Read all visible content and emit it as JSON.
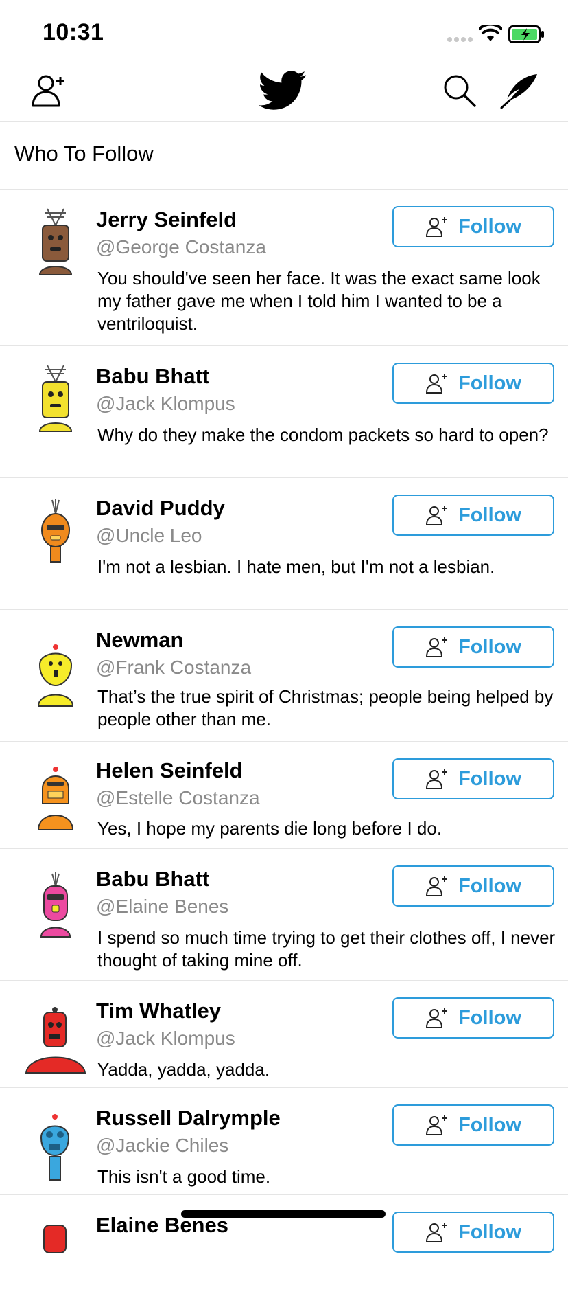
{
  "status_bar": {
    "time": "10:31"
  },
  "header": {
    "title": "Who To Follow"
  },
  "follow_label": "Follow",
  "suggestions": [
    {
      "name": "Jerry Seinfeld",
      "handle": "@George Costanza",
      "quote": "You should've seen her face. It was the exact same look my father gave me when I told him I wanted to be a ventriloquist.",
      "avatar_color": "#8a5a3b"
    },
    {
      "name": "Babu Bhatt",
      "handle": "@Jack Klompus",
      "quote": "Why do they make the condom packets so hard to open?",
      "avatar_color": "#f2e12e"
    },
    {
      "name": "David Puddy",
      "handle": "@Uncle Leo",
      "quote": "I'm not a lesbian. I hate men, but I'm not a lesbian.",
      "avatar_color": "#f08a1d"
    },
    {
      "name": "Newman",
      "handle": "@Frank Costanza",
      "quote": "That’s the true spirit of Christmas; people being helped by people other than me.",
      "avatar_color": "#f6ec2a"
    },
    {
      "name": "Helen Seinfeld",
      "handle": "@Estelle Costanza",
      "quote": "Yes, I hope my parents die long before I do.",
      "avatar_color": "#f5921e"
    },
    {
      "name": "Babu Bhatt",
      "handle": "@Elaine Benes",
      "quote": "I spend so much time trying to get their clothes off, I never thought of taking mine off.",
      "avatar_color": "#ec4aa0"
    },
    {
      "name": "Tim Whatley",
      "handle": "@Jack Klompus",
      "quote": "Yadda, yadda, yadda.",
      "avatar_color": "#e42a26"
    },
    {
      "name": "Russell Dalrymple",
      "handle": "@Jackie Chiles",
      "quote": "This isn't a good time.",
      "avatar_color": "#3aa7de"
    },
    {
      "name": "Elaine Benes",
      "handle": "",
      "quote": "",
      "avatar_color": "#e42a26"
    }
  ],
  "colors": {
    "accent": "#2d9cdb",
    "handle_gray": "#8a8a8a",
    "battery_green": "#4cd964"
  },
  "icons": {
    "nav_left": "add-user-icon",
    "nav_center": "twitter-bird-icon",
    "nav_search": "search-icon",
    "nav_compose": "quill-icon",
    "follow": "add-user-icon"
  }
}
